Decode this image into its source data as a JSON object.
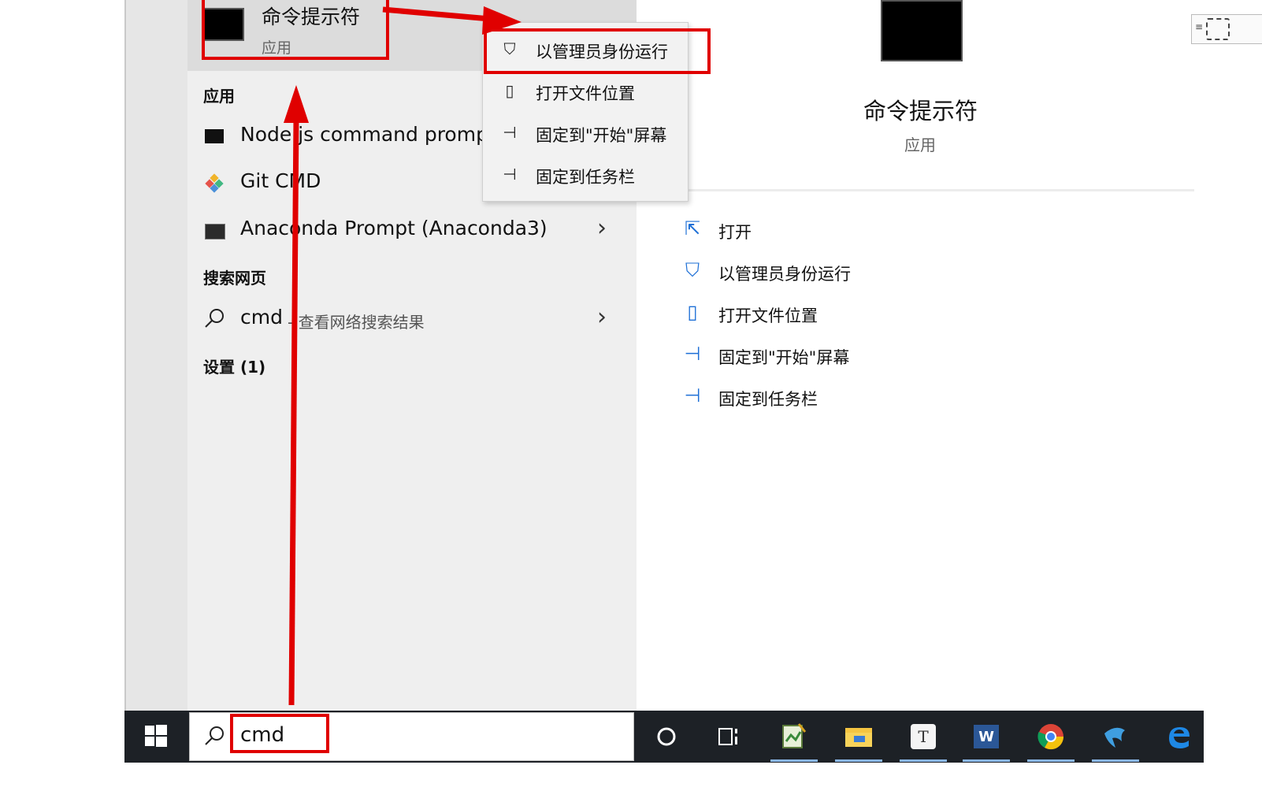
{
  "best_match": {
    "title": "命令提示符",
    "subtitle": "应用"
  },
  "sections": {
    "apps": "应用",
    "web": "搜索网页",
    "settings": "设置 (1)"
  },
  "apps": [
    {
      "label": "Node.js command prompt",
      "icon": "terminal-icon"
    },
    {
      "label": "Git CMD",
      "icon": "git-icon"
    },
    {
      "label": "Anaconda Prompt (Anaconda3)",
      "icon": "terminal-icon"
    }
  ],
  "web_result": {
    "query": "cmd",
    "suffix": "- 查看网络搜索结果"
  },
  "context_menu": [
    {
      "label": "以管理员身份运行",
      "icon": "shield-window-icon"
    },
    {
      "label": "打开文件位置",
      "icon": "file-location-icon"
    },
    {
      "label": "固定到\"开始\"屏幕",
      "icon": "pin-icon"
    },
    {
      "label": "固定到任务栏",
      "icon": "pin-icon"
    }
  ],
  "detail": {
    "title": "命令提示符",
    "subtitle": "应用",
    "actions": [
      {
        "label": "打开",
        "icon": "open-icon"
      },
      {
        "label": "以管理员身份运行",
        "icon": "shield-window-icon"
      },
      {
        "label": "打开文件位置",
        "icon": "file-location-icon"
      },
      {
        "label": "固定到\"开始\"屏幕",
        "icon": "pin-icon"
      },
      {
        "label": "固定到任务栏",
        "icon": "pin-icon"
      }
    ]
  },
  "search": {
    "value": "cmd"
  },
  "taskbar": {
    "icons": [
      "windows-start-icon",
      "cortana-icon",
      "task-view-icon",
      "notepad-icon",
      "file-explorer-icon",
      "typora-icon",
      "word-icon",
      "chrome-icon",
      "dolphin-icon",
      "edge-icon"
    ],
    "word_letter": "W",
    "typora_letter": "T"
  },
  "colors": {
    "annotation": "#e00000",
    "accent": "#1d6fd6",
    "taskbar": "#1d2126"
  }
}
